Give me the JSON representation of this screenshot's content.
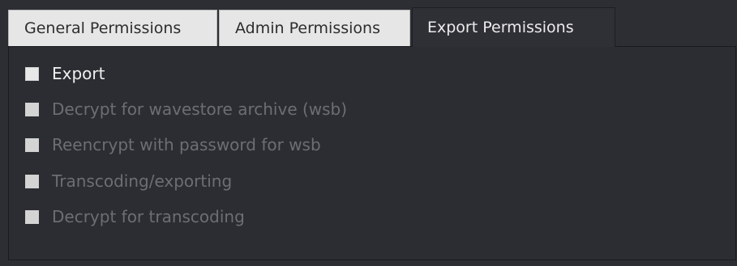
{
  "tabs": [
    {
      "label": "General Permissions",
      "active": false
    },
    {
      "label": "Admin Permissions",
      "active": false
    },
    {
      "label": "Export Permissions",
      "active": true
    }
  ],
  "options": [
    {
      "label": "Export",
      "checked": false,
      "enabled": true
    },
    {
      "label": "Decrypt for wavestore archive (wsb)",
      "checked": false,
      "enabled": false
    },
    {
      "label": "Reencrypt with password for wsb",
      "checked": false,
      "enabled": false
    },
    {
      "label": "Transcoding/exporting",
      "checked": false,
      "enabled": false
    },
    {
      "label": "Decrypt for transcoding",
      "checked": false,
      "enabled": false
    }
  ],
  "colors": {
    "background": "#2c2e34",
    "inactive_tab": "#e6e6e6",
    "active_tab": "#2f3036",
    "enabled_text": "#f0f0f0",
    "disabled_text": "#6c6e73"
  }
}
